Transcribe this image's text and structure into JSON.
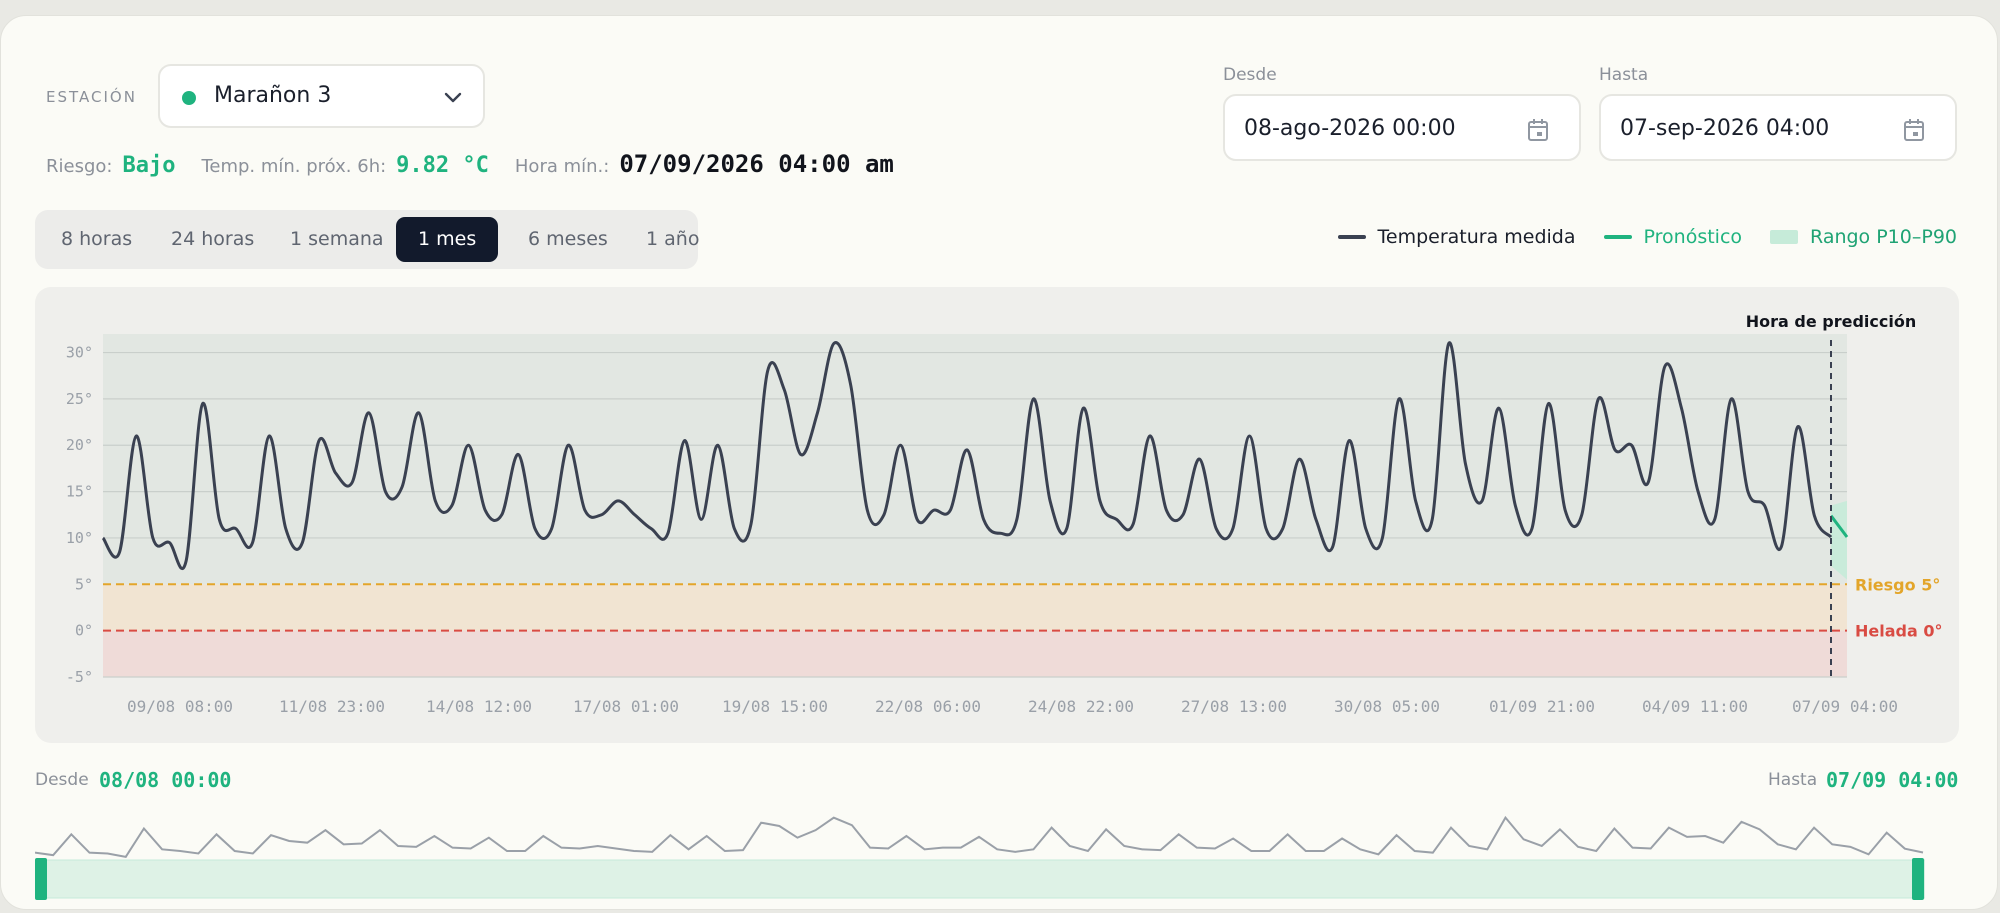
{
  "header": {
    "station_label": "ESTACIÓN",
    "station_name": "Marañon 3",
    "risk_label": "Riesgo:",
    "risk_value": "Bajo",
    "tmin_label": "Temp. mín. próx. 6h:",
    "tmin_value": "9.82 °C",
    "hour_label": "Hora mín.:",
    "hour_value": "07/09/2026 04:00 am"
  },
  "filters": {
    "from_label": "Desde",
    "from_value": "08-ago-2026 00:00",
    "to_label": "Hasta",
    "to_value": "07-sep-2026 04:00"
  },
  "tabs": [
    {
      "label": "8 horas",
      "active": false
    },
    {
      "label": "24 horas",
      "active": false
    },
    {
      "label": "1 semana",
      "active": false
    },
    {
      "label": "1 mes",
      "active": true
    },
    {
      "label": "6 meses",
      "active": false
    },
    {
      "label": "1 año",
      "active": false
    }
  ],
  "legend": {
    "measured": "Temperatura medida",
    "forecast": "Pronóstico",
    "range": "Rango P10–P90"
  },
  "navigator": {
    "from_label": "Desde",
    "from_value": "08/08 00:00",
    "to_label": "Hasta",
    "to_value": "07/09 04:00"
  },
  "colors": {
    "measured": "#3a4151",
    "forecast": "#1fb37f",
    "risk": "#e3a52a",
    "frost": "#d94b43",
    "accent": "#1fb37f"
  },
  "chart_data": {
    "type": "line",
    "ylim": [
      -5,
      32
    ],
    "yticks": [
      "30°",
      "25°",
      "20°",
      "15°",
      "10°",
      "5°",
      "0°",
      "-5°"
    ],
    "ytick_values": [
      30,
      25,
      20,
      15,
      10,
      5,
      0,
      -5
    ],
    "xticks": [
      "09/08 08:00",
      "11/08 23:00",
      "14/08 12:00",
      "17/08 01:00",
      "19/08 15:00",
      "22/08 06:00",
      "24/08 22:00",
      "27/08 13:00",
      "30/08 05:00",
      "01/09 21:00",
      "04/09 11:00",
      "07/09 04:00"
    ],
    "prediction_label": "Hora de predicción",
    "thresholds": [
      {
        "label": "Riesgo 5°",
        "value": 5
      },
      {
        "label": "Helada 0°",
        "value": 0
      }
    ],
    "series": [
      {
        "name": "Temperatura medida",
        "values": [
          10,
          8.5,
          21,
          10,
          9.5,
          7.5,
          24.5,
          12,
          11,
          9.5,
          21,
          11,
          9.5,
          20.5,
          17,
          16,
          23.5,
          15,
          15.5,
          23.5,
          14,
          13.5,
          20,
          13,
          12.5,
          19,
          11,
          11,
          20,
          13,
          12.5,
          14,
          12.5,
          11,
          10.5,
          20.5,
          12,
          20,
          11,
          11.5,
          28,
          26,
          19,
          23.5,
          31,
          26.5,
          13,
          12.5,
          20,
          12,
          13,
          13,
          19.5,
          12,
          10.5,
          12,
          25,
          14,
          11,
          24,
          14,
          12,
          11.5,
          21,
          13,
          12.5,
          18.5,
          11,
          11,
          21,
          11,
          11,
          18.5,
          12,
          9,
          20.5,
          11,
          10,
          25,
          14,
          12,
          31,
          18,
          14,
          24,
          13.5,
          11,
          24.5,
          13,
          12.5,
          25,
          19.5,
          20,
          16,
          28.5,
          24,
          15,
          12,
          25,
          15,
          13.5,
          9,
          22,
          12.4,
          10.1
        ]
      },
      {
        "name": "Pronóstico",
        "values": [
          12.4,
          10.1
        ]
      }
    ]
  }
}
